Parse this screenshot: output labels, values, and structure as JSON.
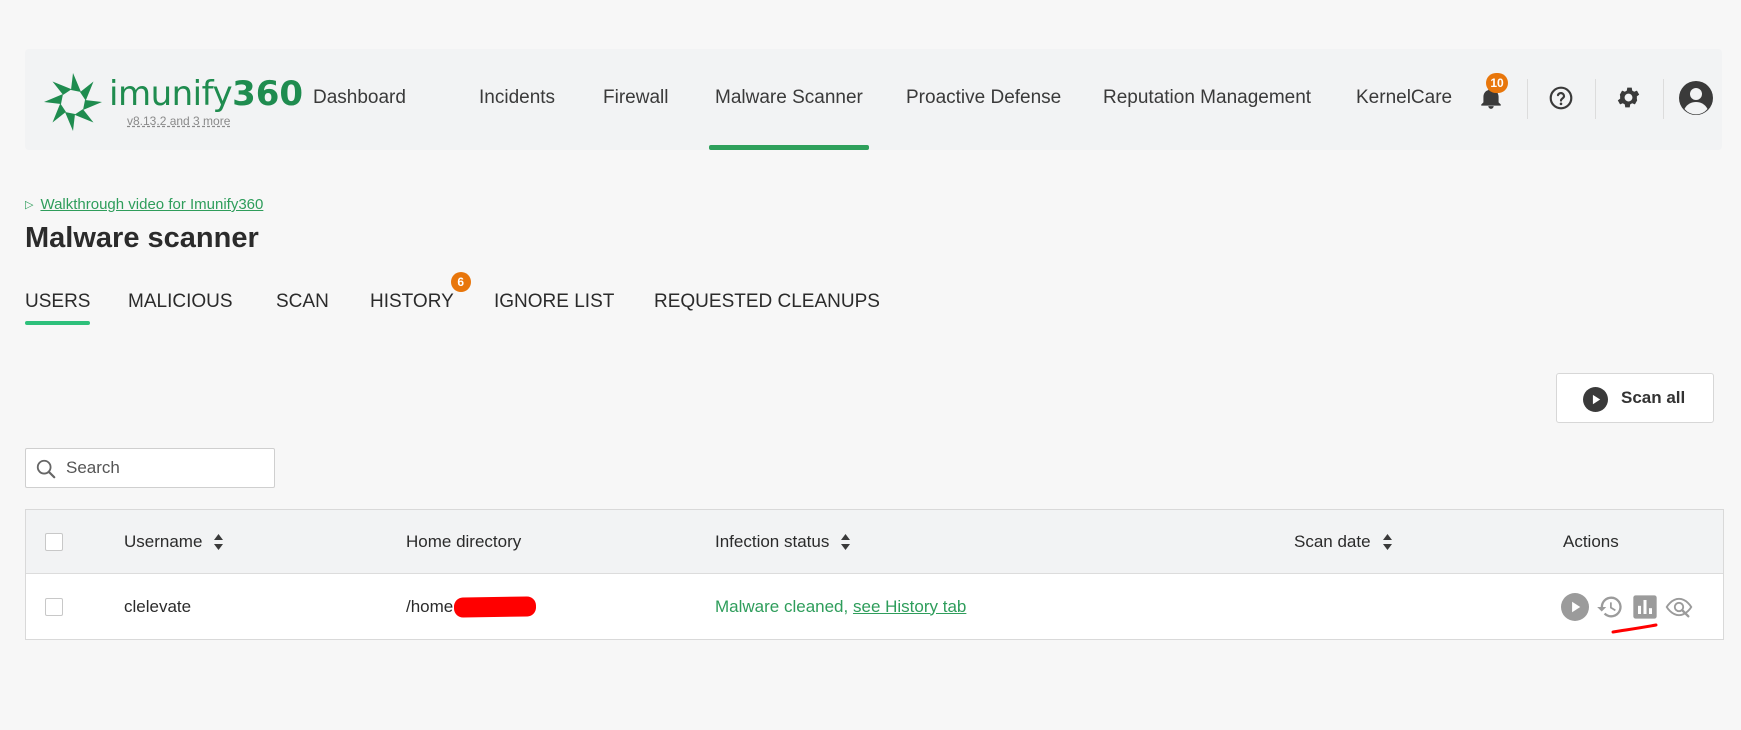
{
  "header": {
    "brand": {
      "word": "imunify",
      "number": "360"
    },
    "version_text": "v8.13.2 and 3 more",
    "nav": [
      {
        "label": "Dashboard"
      },
      {
        "label": "Incidents"
      },
      {
        "label": "Firewall"
      },
      {
        "label": "Malware Scanner",
        "active": true
      },
      {
        "label": "Proactive Defense"
      },
      {
        "label": "Reputation Management"
      },
      {
        "label": "KernelCare"
      }
    ],
    "notifications_count": "10",
    "icons": [
      "bell-icon",
      "help-icon",
      "gear-icon",
      "user-avatar-icon"
    ]
  },
  "page": {
    "walkthrough_link": "Walkthrough video for Imunify360",
    "title": "Malware scanner",
    "tabs": [
      {
        "label": "USERS",
        "active": true
      },
      {
        "label": "MALICIOUS"
      },
      {
        "label": "SCAN"
      },
      {
        "label": "HISTORY",
        "badge": "6"
      },
      {
        "label": "IGNORE LIST"
      },
      {
        "label": "REQUESTED CLEANUPS"
      }
    ],
    "scan_all_label": "Scan all",
    "search_placeholder": "Search"
  },
  "table": {
    "columns": [
      {
        "label": "Username",
        "sortable": true
      },
      {
        "label": "Home directory",
        "sortable": false
      },
      {
        "label": "Infection status",
        "sortable": true
      },
      {
        "label": "Scan date",
        "sortable": true
      },
      {
        "label": "Actions",
        "sortable": false
      }
    ],
    "rows": [
      {
        "username": "clelevate",
        "home_directory": "/home",
        "status_text": "Malware cleaned,",
        "status_link": "see History tab",
        "scan_date": "",
        "actions": [
          "play-icon",
          "history-icon",
          "bar-chart-icon",
          "eye-search-icon"
        ]
      }
    ]
  },
  "colors": {
    "brand_green": "#1f8c4f",
    "accent_green": "#2ea05b",
    "badge_orange": "#e8760b",
    "annotation_red": "#ff0000"
  }
}
